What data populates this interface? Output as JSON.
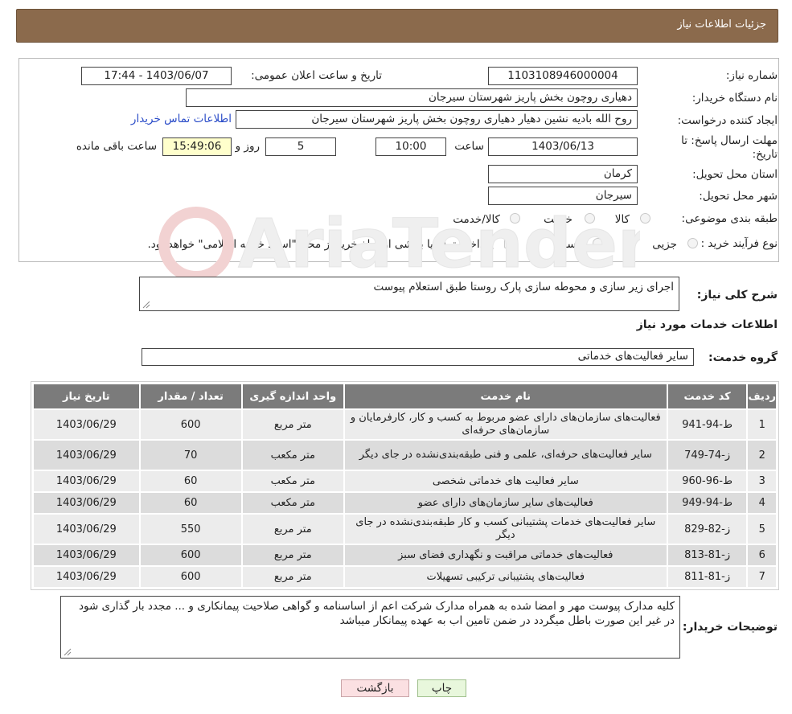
{
  "page": {
    "title": "جزئیات اطلاعات نیاز"
  },
  "need": {
    "number_label": "شماره نیاز:",
    "number": "1103108946000004",
    "announce_label": "تاریخ و ساعت اعلان عمومی:",
    "announce": "1403/06/07 - 17:44",
    "buyer_label": "نام دستگاه خریدار:",
    "buyer": "دهیاری روچون بخش پاریز شهرستان سیرجان",
    "creator_label": "ایجاد کننده درخواست:",
    "creator": "روح الله بادیه نشین دهیار دهیاری روچون بخش پاریز شهرستان سیرجان",
    "contact_link": "اطلاعات تماس خریدار",
    "deadline_label_1": "مهلت ارسال پاسخ: تا",
    "deadline_label_2": "تاریخ:",
    "deadline_date": "1403/06/13",
    "time_label": "ساعت",
    "deadline_time": "10:00",
    "days": "5",
    "days_label": "روز و",
    "remaining": "15:49:06",
    "remaining_label": "ساعت باقی مانده",
    "province_label": "استان محل تحویل:",
    "province": "کرمان",
    "city_label": "شهر محل تحویل:",
    "city": "سیرجان",
    "category_label": "طبقه بندی موضوعی:",
    "category_options": [
      "کالا",
      "خدمت",
      "کالا/خدمت"
    ],
    "process_label": "نوع فرآیند خرید :",
    "process_options": [
      "جزیی",
      "متوسط"
    ],
    "payment_note": "پرداخت تمام یا بخشی از مبلغ خرید،از محل \"اسناد خزانه اسلامی\" خواهد بود."
  },
  "summary": {
    "label": "شرح کلی نیاز:",
    "text": "اجرای زیر سازی و محوطه سازی پارک روستا طبق استعلام پیوست"
  },
  "services": {
    "section_title": "اطلاعات خدمات مورد نیاز",
    "group_label": "گروه خدمت:",
    "group": "سایر فعالیت‌های خدماتی",
    "columns": [
      "ردیف",
      "کد خدمت",
      "نام خدمت",
      "واحد اندازه گیری",
      "تعداد / مقدار",
      "تاریخ نیاز"
    ],
    "rows": [
      [
        "1",
        "ط-94-941",
        "فعالیت‌های سازمان‌های دارای عضو مربوط به کسب و کار، کارفرمایان و سازمان‌های حرفه‌ای",
        "متر مربع",
        "600",
        "1403/06/29"
      ],
      [
        "2",
        "ز-74-749",
        "سایر فعالیت‌های حرفه‌ای، علمی و فنی طبقه‌بندی‌نشده در جای دیگر",
        "متر مکعب",
        "70",
        "1403/06/29"
      ],
      [
        "3",
        "ط-96-960",
        "سایر فعالیت های خدماتی شخصی",
        "متر مکعب",
        "60",
        "1403/06/29"
      ],
      [
        "4",
        "ط-94-949",
        "فعالیت‌های سایر سازمان‌های دارای عضو",
        "متر مکعب",
        "60",
        "1403/06/29"
      ],
      [
        "5",
        "ز-82-829",
        "سایر فعالیت‌های خدمات پشتیبانی کسب و کار طبقه‌بندی‌نشده در جای دیگر",
        "متر مربع",
        "550",
        "1403/06/29"
      ],
      [
        "6",
        "ز-81-813",
        "فعالیت‌های خدماتی مراقبت و نگهداری فضای سبز",
        "متر مربع",
        "600",
        "1403/06/29"
      ],
      [
        "7",
        "ز-81-811",
        "فعالیت‌های پشتیبانی ترکیبی تسهیلات",
        "متر مربع",
        "600",
        "1403/06/29"
      ]
    ]
  },
  "buyer_notes": {
    "label": "توضیحات خریدار:",
    "text": "کلیه مدارک پیوست مهر و امضا شده به همراه مدارک شرکت اعم از اساسنامه و گواهی صلاحیت پیمانکاری و ... مجدد بار گذاری شود در غیر این صورت باطل میگردد در ضمن تامین اب به عهده پیمانکار میباشد"
  },
  "buttons": {
    "print": "چاپ",
    "back": "بازگشت"
  },
  "colors": {
    "header_bg": "#8b6a4c",
    "table_header_bg": "#7b7b7b",
    "link": "#2a4cc8"
  }
}
